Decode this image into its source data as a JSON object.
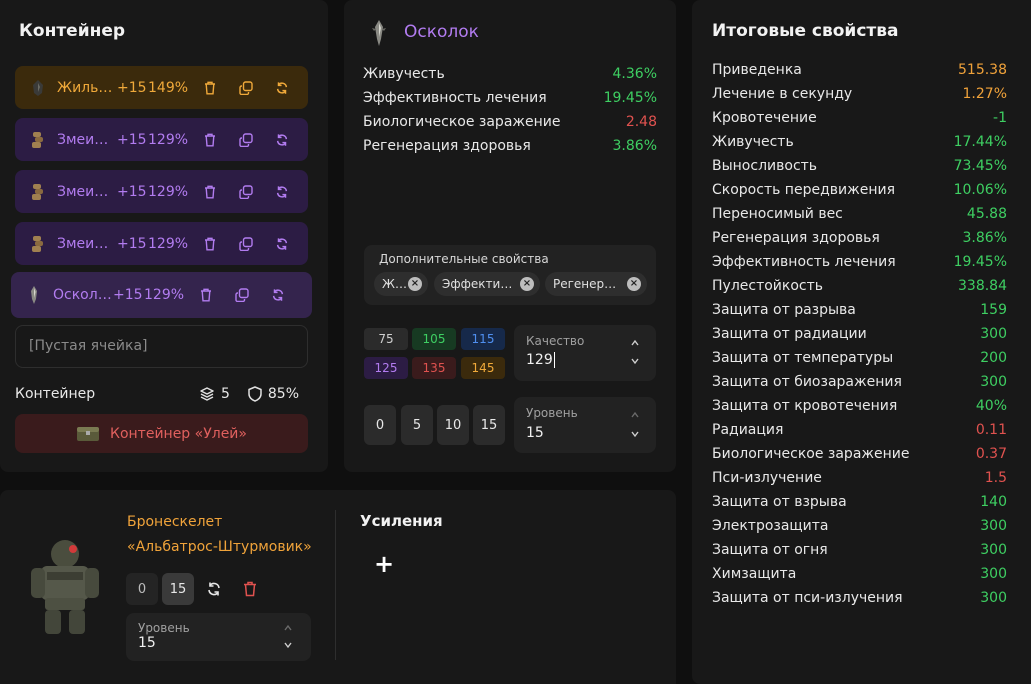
{
  "container": {
    "title": "Контейнер",
    "slots": [
      {
        "name": "Жильный",
        "level": "+15",
        "pct": "149%",
        "color": "gold"
      },
      {
        "name": "Змеиный",
        "level": "+15",
        "pct": "129%",
        "color": "purple"
      },
      {
        "name": "Змеиный",
        "level": "+15",
        "pct": "129%",
        "color": "purple"
      },
      {
        "name": "Змеиный",
        "level": "+15",
        "pct": "129%",
        "color": "purple"
      },
      {
        "name": "Осколок",
        "level": "+15",
        "pct": "129%",
        "color": "purple"
      }
    ],
    "empty_slot": "[Пустая ячейка]",
    "footer_label": "Контейнер",
    "capacity": "5",
    "protection": "85%",
    "container_button": "Контейнер «Улей»"
  },
  "shard": {
    "title": "Осколок",
    "stats": [
      {
        "label": "Живучесть",
        "value": "4.36%",
        "color": "green"
      },
      {
        "label": "Эффективность лечения",
        "value": "19.45%",
        "color": "green"
      },
      {
        "label": "Биологическое заражение",
        "value": "2.48",
        "color": "red"
      },
      {
        "label": "Регенерация здоровья",
        "value": "3.86%",
        "color": "green"
      }
    ],
    "extra_title": "Дополнительные свойства",
    "extra_chips": [
      "Живучесть",
      "Эффективность лечения",
      "Регенерация здоровья"
    ],
    "quality_presets": [
      "75",
      "105",
      "115",
      "125",
      "135",
      "145"
    ],
    "quality_label": "Качество",
    "quality_value": "129",
    "level_presets": [
      "0",
      "5",
      "10",
      "15"
    ],
    "level_label": "Уровень",
    "level_value": "15"
  },
  "armor": {
    "name_line1": "Бронескелет",
    "name_line2": "«Альбатрос-Штурмовик»",
    "level_presets": [
      "0",
      "15"
    ],
    "level_label": "Уровень",
    "level_value": "15",
    "boosts_title": "Усиления",
    "add_symbol": "+"
  },
  "totals": {
    "title": "Итоговые свойства",
    "rows": [
      {
        "label": "Приведенка",
        "value": "515.38",
        "color": "orange"
      },
      {
        "label": "Лечение в секунду",
        "value": "1.27%",
        "color": "orange"
      },
      {
        "label": "Кровотечение",
        "value": "-1",
        "color": "green"
      },
      {
        "label": "Живучесть",
        "value": "17.44%",
        "color": "green"
      },
      {
        "label": "Выносливость",
        "value": "73.45%",
        "color": "green"
      },
      {
        "label": "Скорость передвижения",
        "value": "10.06%",
        "color": "green"
      },
      {
        "label": "Переносимый вес",
        "value": "45.88",
        "color": "green"
      },
      {
        "label": "Регенерация здоровья",
        "value": "3.86%",
        "color": "green"
      },
      {
        "label": "Эффективность лечения",
        "value": "19.45%",
        "color": "green"
      },
      {
        "label": "Пулестойкость",
        "value": "338.84",
        "color": "green"
      },
      {
        "label": "Защита от разрыва",
        "value": "159",
        "color": "green"
      },
      {
        "label": "Защита от радиации",
        "value": "300",
        "color": "green"
      },
      {
        "label": "Защита от температуры",
        "value": "200",
        "color": "green"
      },
      {
        "label": "Защита от биозаражения",
        "value": "300",
        "color": "green"
      },
      {
        "label": "Защита от кровотечения",
        "value": "40%",
        "color": "green"
      },
      {
        "label": "Радиация",
        "value": "0.11",
        "color": "red"
      },
      {
        "label": "Биологическое заражение",
        "value": "0.37",
        "color": "red"
      },
      {
        "label": "Пси-излучение",
        "value": "1.5",
        "color": "red"
      },
      {
        "label": "Защита от взрыва",
        "value": "140",
        "color": "green"
      },
      {
        "label": "Электрозащита",
        "value": "300",
        "color": "green"
      },
      {
        "label": "Защита от огня",
        "value": "300",
        "color": "green"
      },
      {
        "label": "Химзащита",
        "value": "300",
        "color": "green"
      },
      {
        "label": "Защита от пси-излучения",
        "value": "300",
        "color": "green"
      }
    ]
  },
  "colors": {
    "gold": "#f0a93a",
    "purple": "#b27cf0",
    "green": "#3ecf62",
    "red": "#e0524f",
    "orange": "#f0a23a"
  }
}
